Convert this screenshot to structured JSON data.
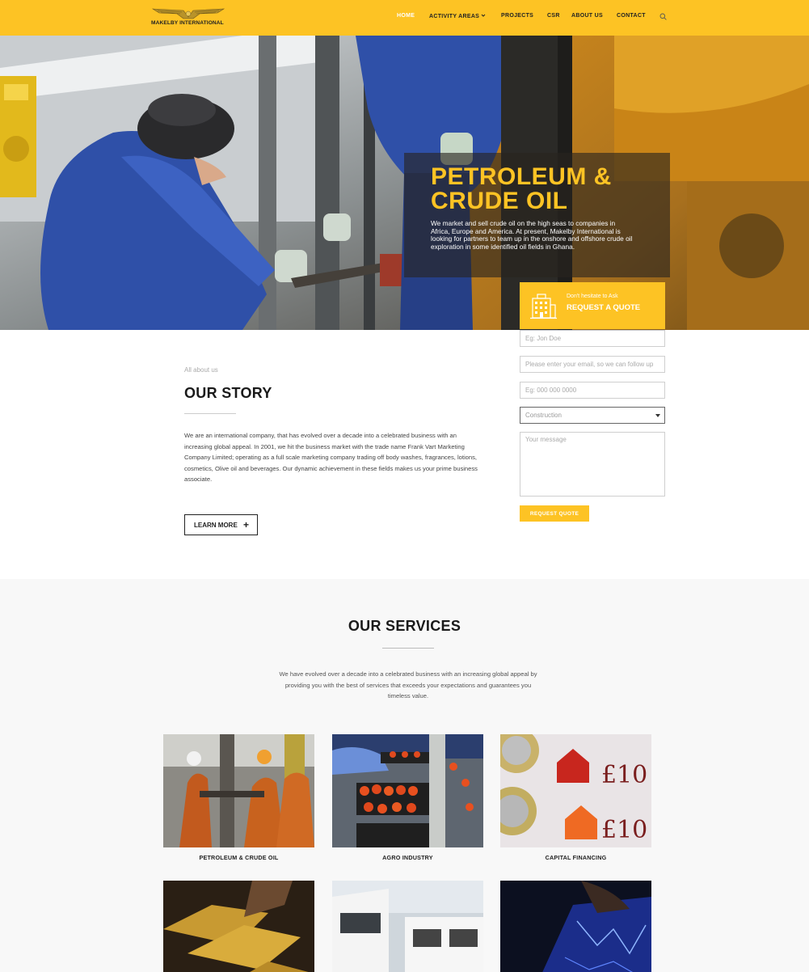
{
  "header": {
    "brand": "MAKELBY INTERNATIONAL",
    "nav": [
      "HOME",
      "ACTIVITY AREAS",
      "PROJECTS",
      "CSR",
      "ABOUT US",
      "CONTACT"
    ],
    "nav_dropdown": "chevron-down-icon",
    "search_icon": "search-icon",
    "accent_color": "#fdc324"
  },
  "hero": {
    "title": "PETROLEUM & CRUDE OIL",
    "text": "We market and sell crude oil on the high seas to companies in Africa, Europe and America. At present, Makelby International is looking for partners to team up in the onshore and offshore crude oil exploration in some identified oil fields in Ghana."
  },
  "quote": {
    "small": "Don't hesitate to Ask",
    "big": "REQUEST A QUOTE",
    "icon": "building-icon",
    "name_placeholder": "Eg: Jon Doe",
    "email_placeholder": "Please enter your email, so we can follow up",
    "phone_placeholder": "Eg: 000 000 0000",
    "select_value": "Construction",
    "message_placeholder": "Your message",
    "button": "REQUEST QUOTE"
  },
  "story": {
    "kicker": "All about us",
    "title": "OUR STORY",
    "text": "We are an international company, that has evolved over a decade into a celebrated business with an increasing global appeal. In 2001, we hit the business market with the trade name Frank Vart Marketing Company Limited; operating as a full scale marketing company trading off body washes, fragrances, lotions, cosmetics, Olive oil and beverages. Our  dynamic achievement in these fields makes us your prime business associate.",
    "button": "LEARN MORE",
    "button_icon": "plus-icon"
  },
  "services": {
    "title": "OUR SERVICES",
    "text": "We have evolved over a decade into a celebrated business with an increasing global appeal by providing you with the best of services that exceeds your expectations and guarantees you timeless value.",
    "cards": [
      {
        "label": "PETROLEUM & CRUDE OIL"
      },
      {
        "label": "AGRO INDUSTRY"
      },
      {
        "label": "CAPITAL FINANCING"
      },
      {
        "label": ""
      },
      {
        "label": ""
      },
      {
        "label": ""
      }
    ]
  }
}
